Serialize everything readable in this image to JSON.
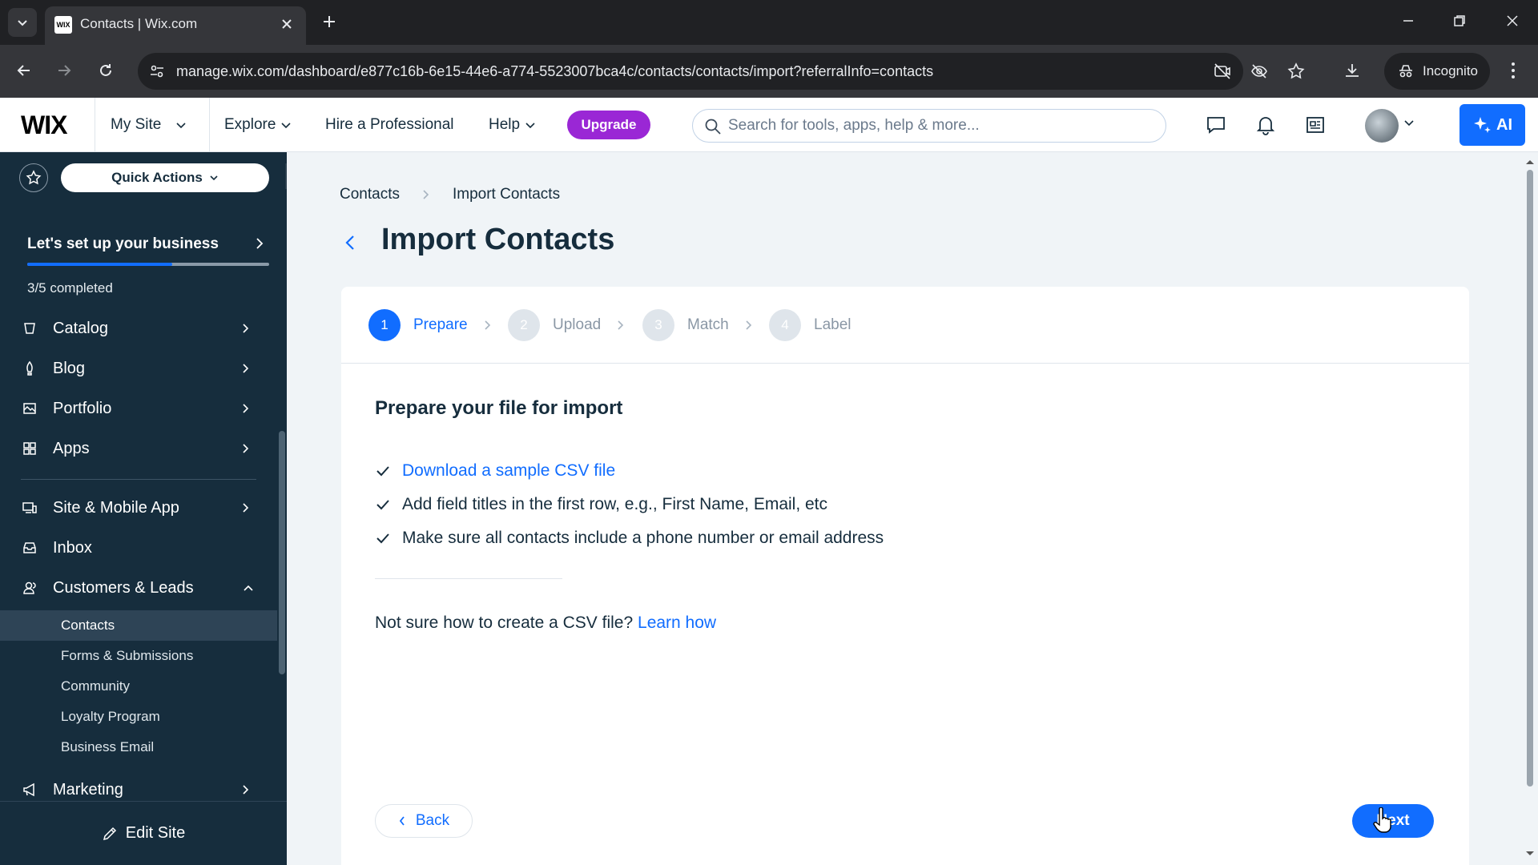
{
  "browser": {
    "tab_title": "Contacts | Wix.com",
    "favicon_text": "WIX",
    "url": "manage.wix.com/dashboard/e877c16b-6e15-44e6-a774-5523007bca4c/contacts/contacts/import?referralInfo=contacts",
    "incognito_label": "Incognito"
  },
  "topbar": {
    "logo": "WIX",
    "my_site": "My Site",
    "explore": "Explore",
    "hire": "Hire a Professional",
    "help": "Help",
    "upgrade": "Upgrade",
    "search_placeholder": "Search for tools, apps, help & more...",
    "ai_label": "AI"
  },
  "sidebar": {
    "quick_actions": "Quick Actions",
    "setup_title": "Let's set up your business",
    "setup_progress": 0.6,
    "setup_sub": "3/5 completed",
    "items": [
      {
        "label": "Catalog"
      },
      {
        "label": "Blog"
      },
      {
        "label": "Portfolio"
      },
      {
        "label": "Apps"
      },
      {
        "label": "Site & Mobile App"
      },
      {
        "label": "Inbox"
      },
      {
        "label": "Customers & Leads"
      },
      {
        "label": "Marketing"
      }
    ],
    "subitems": [
      {
        "label": "Contacts"
      },
      {
        "label": "Forms & Submissions"
      },
      {
        "label": "Community"
      },
      {
        "label": "Loyalty Program"
      },
      {
        "label": "Business Email"
      }
    ],
    "edit_site": "Edit Site"
  },
  "main": {
    "breadcrumb": [
      "Contacts",
      "Import Contacts"
    ],
    "title": "Import Contacts",
    "steps": [
      {
        "num": "1",
        "label": "Prepare"
      },
      {
        "num": "2",
        "label": "Upload"
      },
      {
        "num": "3",
        "label": "Match"
      },
      {
        "num": "4",
        "label": "Label"
      }
    ],
    "prep_title": "Prepare your file for import",
    "checklist": [
      "Download a sample CSV file",
      "Add field titles in the first row, e.g., First Name, Email, etc",
      "Make sure all contacts include a phone number or email address"
    ],
    "help_text": "Not sure how to create a CSV file?",
    "help_link": "Learn how",
    "back_label": "Back",
    "next_label": "Next"
  },
  "colors": {
    "accent": "#116dff",
    "upgrade": "#9a27d5",
    "sidebar": "#162d3d"
  }
}
